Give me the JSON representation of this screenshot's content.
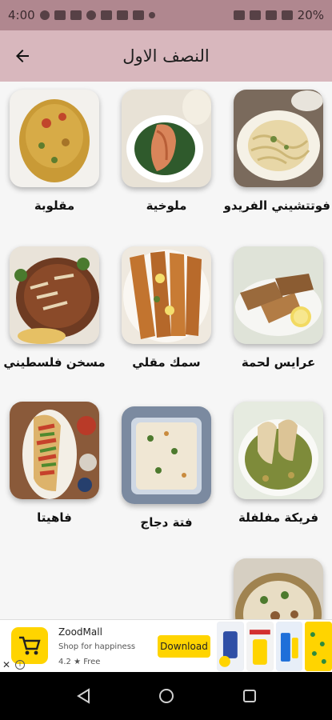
{
  "status_bar": {
    "time": "4:00",
    "battery": "20%"
  },
  "app_bar": {
    "title": "النصف الاول",
    "back_icon": "arrow-back-icon"
  },
  "recipes": [
    {
      "name": "فوتتشيني الفريدو"
    },
    {
      "name": "ملوخية"
    },
    {
      "name": "مقلوبة"
    },
    {
      "name": "عرايس لحمة"
    },
    {
      "name": "سمك مقلي"
    },
    {
      "name": "مسخن فلسطيني"
    },
    {
      "name": "فريكة مفلفلة"
    },
    {
      "name": "فتة دجاج"
    },
    {
      "name": "فاهيتا"
    },
    {
      "name": ""
    }
  ],
  "ad": {
    "app_name": "ZoodMall",
    "tagline": "Shop for happiness",
    "rating": "4.2 ★  Free",
    "download_label": "Download",
    "close_label": "✕",
    "info_label": "i",
    "accent_color": "#ffd400"
  },
  "colors": {
    "status_bar": "#b0878f",
    "app_bar": "#d8b7bd",
    "content_bg": "#f6f6f6"
  }
}
